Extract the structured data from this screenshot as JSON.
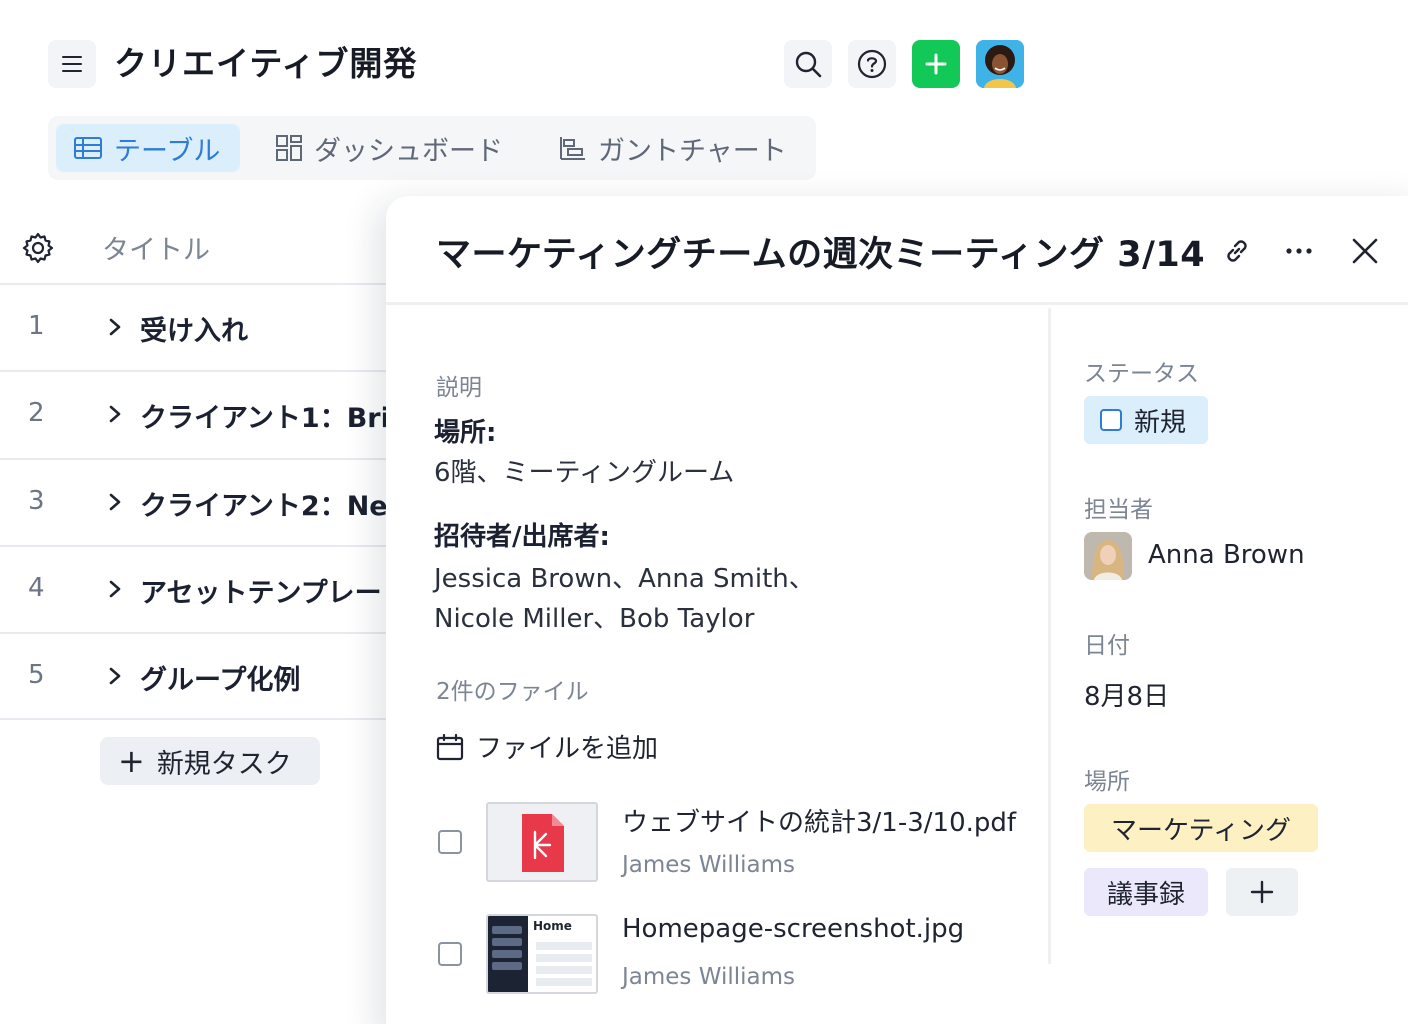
{
  "header": {
    "title": "クリエイティブ開発"
  },
  "view_tabs": [
    {
      "label": "テーブル",
      "icon": "table-icon",
      "active": true
    },
    {
      "label": "ダッシュボード",
      "icon": "dashboard-icon",
      "active": false
    },
    {
      "label": "ガントチャート",
      "icon": "gantt-icon",
      "active": false
    }
  ],
  "table": {
    "column_title": "タイトル",
    "rows": [
      {
        "num": "1",
        "label": "受け入れ"
      },
      {
        "num": "2",
        "label": "クライアント1：Bri"
      },
      {
        "num": "3",
        "label": "クライアント2：Ne"
      },
      {
        "num": "4",
        "label": "アセットテンプレー"
      },
      {
        "num": "5",
        "label": "グループ化例"
      }
    ],
    "new_task_label": "新規タスク"
  },
  "panel": {
    "title": "マーケティングチームの週次ミーティング 3/14",
    "description_label": "説明",
    "location_heading": "場所:",
    "location_text": "6階、ミーティングルーム",
    "attendees_heading": "招待者/出席者:",
    "attendees_line1": "Jessica Brown、Anna Smith、",
    "attendees_line2": "Nicole Miller、Bob Taylor",
    "files_label": "2件のファイル",
    "add_file_label": "ファイルを追加",
    "files": [
      {
        "name": "ウェブサイトの統計3/1-3/10.pdf",
        "author": "James Williams",
        "type": "pdf"
      },
      {
        "name": "Homepage-screenshot.jpg",
        "author": "James Williams",
        "type": "image",
        "thumb_text": "Home"
      }
    ],
    "status_label": "ステータス",
    "status_value": "新規",
    "assignee_label": "担当者",
    "assignee_name": "Anna Brown",
    "date_label": "日付",
    "date_value": "8月8日",
    "place_label": "場所",
    "tags": [
      "マーケティング",
      "議事録"
    ]
  },
  "colors": {
    "accent_blue": "#2f7bd6",
    "add_green": "#12c856",
    "pdf_red": "#e8394a"
  }
}
